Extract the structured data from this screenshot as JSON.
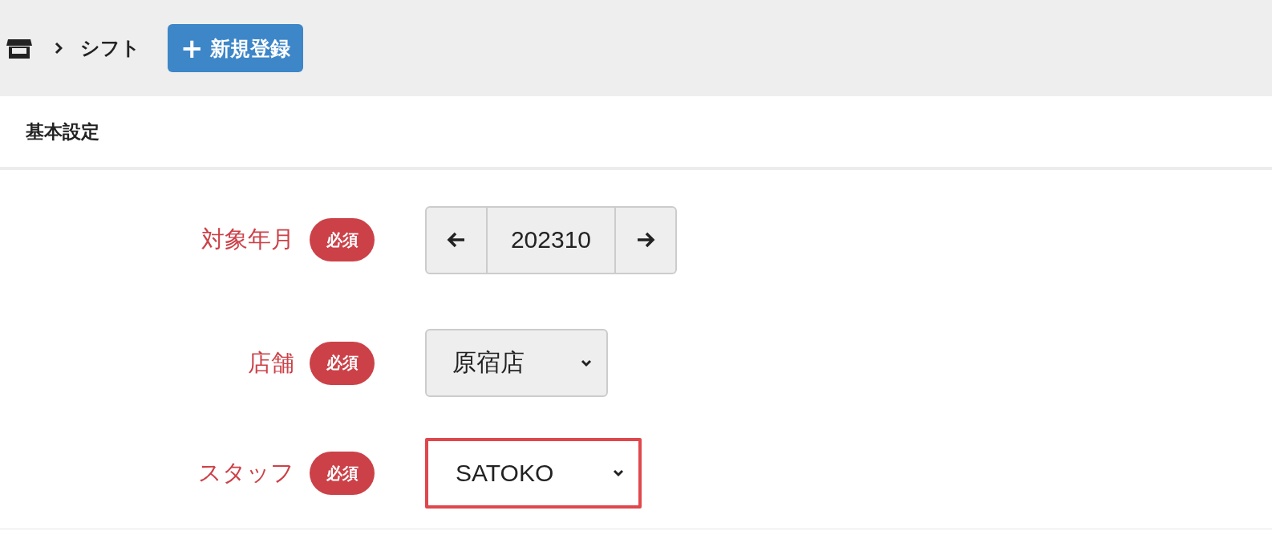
{
  "breadcrumb": {
    "items": [
      {
        "label": "シフト"
      }
    ]
  },
  "new_button": {
    "icon": "+",
    "label": "新規登録"
  },
  "section": {
    "title": "基本設定"
  },
  "fields": [
    {
      "kind": "stepper",
      "label": "対象年月",
      "badge": "必須",
      "value": "202310",
      "highlighted": false
    },
    {
      "kind": "select",
      "label": "店舗",
      "badge": "必須",
      "value": "原宿店",
      "highlighted": false
    },
    {
      "kind": "select",
      "label": "スタッフ",
      "badge": "必須",
      "value": "SATOKO",
      "highlighted": true
    }
  ]
}
